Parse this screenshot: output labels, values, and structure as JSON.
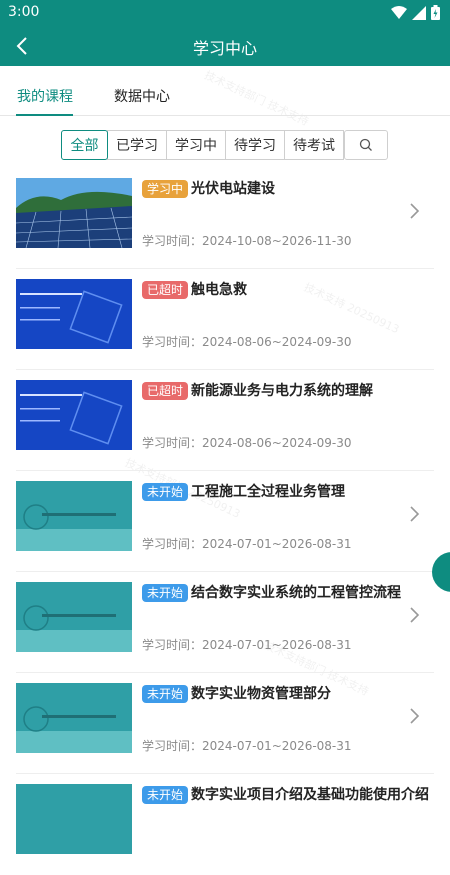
{
  "status_bar": {
    "time": "3:00"
  },
  "app_bar": {
    "title": "学习中心"
  },
  "tabs": [
    {
      "label": "我的课程",
      "active": true
    },
    {
      "label": "数据中心",
      "active": false
    }
  ],
  "filters": [
    {
      "label": "全部",
      "active": true
    },
    {
      "label": "已学习",
      "active": false
    },
    {
      "label": "学习中",
      "active": false
    },
    {
      "label": "待学习",
      "active": false
    },
    {
      "label": "待考试",
      "active": false
    }
  ],
  "colors": {
    "primary": "#0e8c80",
    "badge_learning": "#e8a23b",
    "badge_overdue": "#e86a6a",
    "badge_not_started": "#3d9bea"
  },
  "courses": [
    {
      "status": "学习中",
      "status_color": "#e8a23b",
      "title": "光伏电站建设",
      "time": "学习时间：2024-10-08~2026-11-30",
      "thumb": "solar",
      "chevron": true
    },
    {
      "status": "已超时",
      "status_color": "#e86a6a",
      "title": "触电急救",
      "time": "学习时间：2024-08-06~2024-09-30",
      "thumb": "blue-slide",
      "chevron": false
    },
    {
      "status": "已超时",
      "status_color": "#e86a6a",
      "title": "新能源业务与电力系统的理解",
      "time": "学习时间：2024-08-06~2024-09-30",
      "thumb": "blue-slide",
      "chevron": false
    },
    {
      "status": "未开始",
      "status_color": "#3d9bea",
      "title": "工程施工全过程业务管理",
      "time": "学习时间：2024-07-01~2026-08-31",
      "thumb": "teal",
      "chevron": true
    },
    {
      "status": "未开始",
      "status_color": "#3d9bea",
      "title": "结合数字实业系统的工程管控流程",
      "time": "学习时间：2024-07-01~2026-08-31",
      "thumb": "teal",
      "chevron": true
    },
    {
      "status": "未开始",
      "status_color": "#3d9bea",
      "title": "数字实业物资管理部分",
      "time": "学习时间：2024-07-01~2026-08-31",
      "thumb": "teal",
      "chevron": true
    },
    {
      "status": "未开始",
      "status_color": "#3d9bea",
      "title": "数字实业项目介绍及基础功能使用介绍",
      "time": "",
      "thumb": "teal",
      "chevron": false
    }
  ]
}
